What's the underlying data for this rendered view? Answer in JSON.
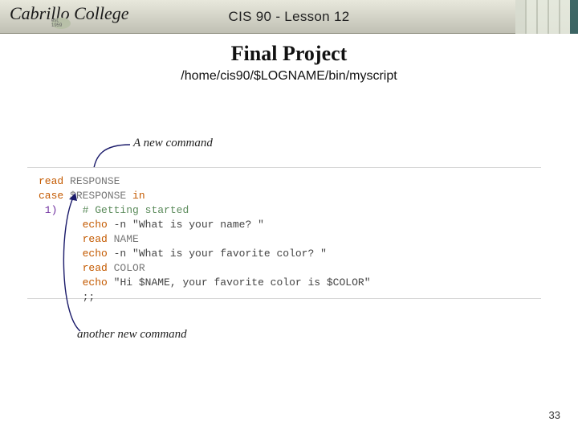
{
  "header": {
    "logo_text": "Cabrillo College",
    "logo_badge": "est. 1959",
    "lesson": "CIS 90 - Lesson 12"
  },
  "title": "Final Project",
  "script_path": "/home/cis90/$LOGNAME/bin/myscript",
  "annotations": {
    "top": "A new command",
    "bottom": "another new command"
  },
  "code": {
    "l1a": "read",
    "l1b": " RESPONSE",
    "l2a": "case",
    "l2b": " $RESPONSE ",
    "l2c": "in",
    "l3a": " 1)",
    "l3b": "    ",
    "l3c": "# Getting started",
    "l4a": "       ",
    "l4b": "echo",
    "l4c": " -n ",
    "l4d": "\"What is your name? \"",
    "l5a": "       ",
    "l5b": "read",
    "l5c": " NAME",
    "l6a": "       ",
    "l6b": "echo",
    "l6c": " -n ",
    "l6d": "\"What is your favorite color? \"",
    "l7a": "       ",
    "l7b": "read",
    "l7c": " COLOR",
    "l8a": "       ",
    "l8b": "echo",
    "l8c": " ",
    "l8d": "\"Hi $NAME, your favorite color is $COLOR\"",
    "l9": "       ;;"
  },
  "page_number": "33"
}
